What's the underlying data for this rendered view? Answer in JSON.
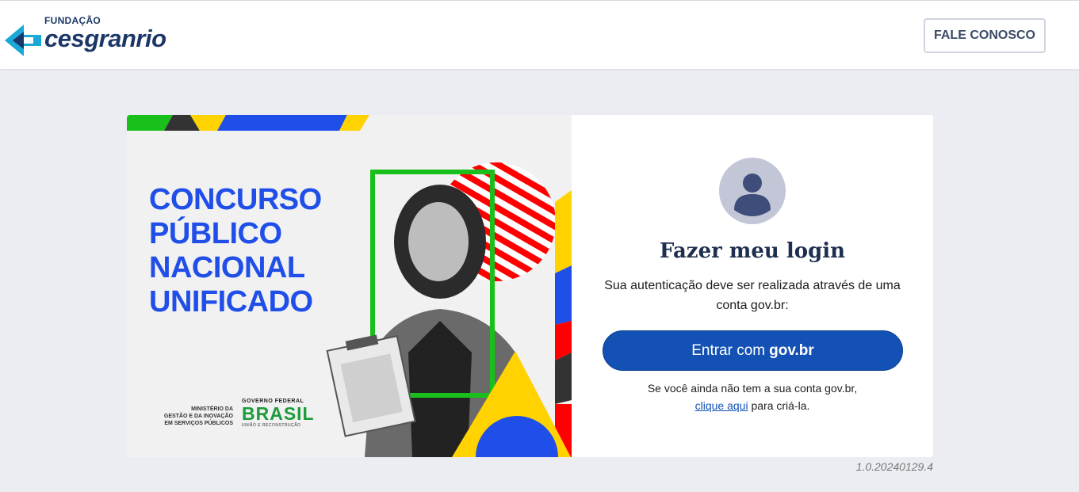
{
  "header": {
    "brand_small": "FUNDAÇÃO",
    "brand_name": "cesgranrio",
    "contact_label": "FALE CONOSCO"
  },
  "banner": {
    "title_lines": [
      "CONCURSO",
      "PÚBLICO",
      "NACIONAL",
      "UNIFICADO"
    ],
    "ministry_lines": [
      "MINISTÉRIO DA",
      "GESTÃO E DA INOVAÇÃO",
      "EM SERVIÇOS PÚBLICOS"
    ],
    "gov_federal": "GOVERNO FEDERAL",
    "brasil": "BRASIL",
    "uniao": "UNIÃO E RECONSTRUÇÃO"
  },
  "login": {
    "title": "Fazer meu login",
    "description": "Sua autenticação deve ser realizada através de uma conta gov.br:",
    "button_prefix": "Entrar com",
    "button_bold": "gov.br",
    "note_text": "Se você ainda não tem a sua conta gov.br,",
    "note_link": "clique aqui",
    "note_suffix": "para criá-la."
  },
  "version": "1.0.20240129.4",
  "colors": {
    "brand_navy": "#1b3767",
    "brand_cyan": "#1aa8d8",
    "gov_blue": "#1351b4",
    "banner_blue": "#1f4ee8",
    "banner_green": "#19c01c",
    "banner_yellow": "#ffd200",
    "banner_red": "#ff0000",
    "page_bg": "#ecedf2"
  }
}
